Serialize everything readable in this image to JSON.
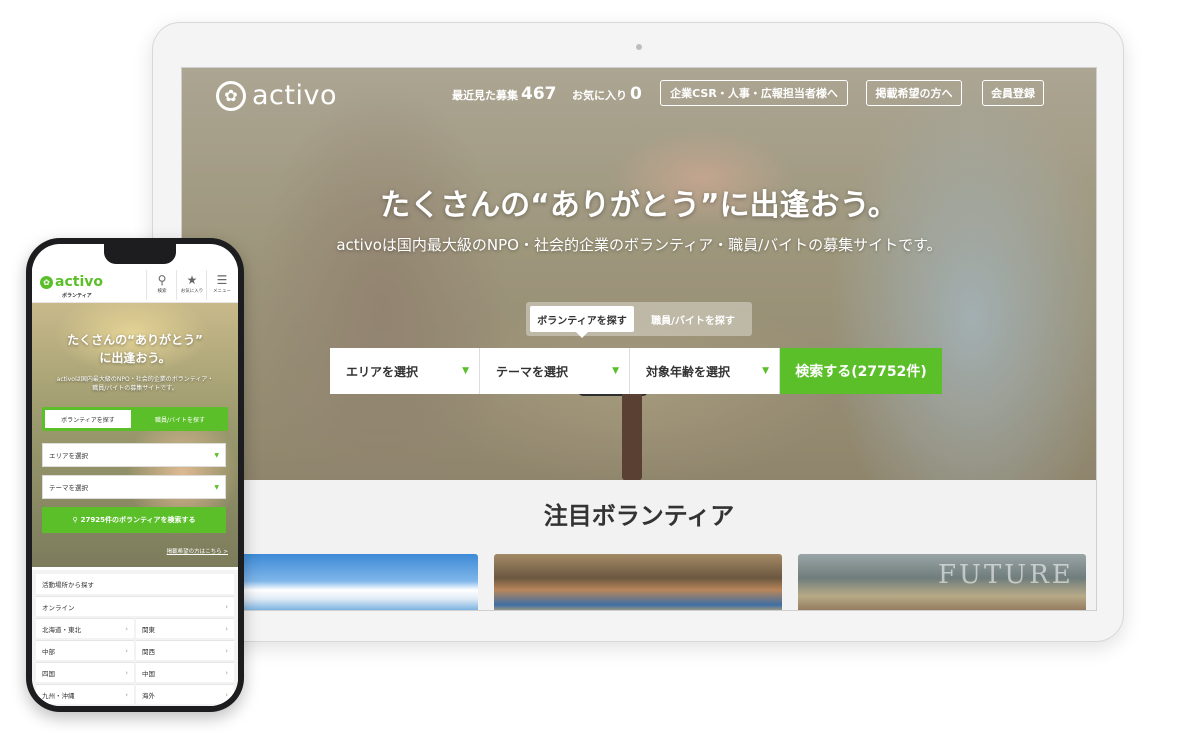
{
  "desktop": {
    "logo_text": "activo",
    "nav": {
      "recent_label": "最近見た募集",
      "recent_count": "467",
      "favorites_label": "お気に入り",
      "favorites_count": "0",
      "corporate_button": "企業CSR・人事・広報担当者様へ",
      "listing_button": "掲載希望の方へ",
      "signup_button": "会員登録"
    },
    "hero": {
      "title": "たくさんの“ありがとう”に出逢おう。",
      "subtitle": "activoは国内最大級のNPO・社会的企業のボランティア・職員/バイトの募集サイトです。"
    },
    "tabs": {
      "active": "ボランティアを探す",
      "inactive": "職員/バイトを探す"
    },
    "search": {
      "area": "エリアを選択",
      "theme": "テーマを選択",
      "age": "対象年齢を選択",
      "button": "検索する(27752件)"
    },
    "featured_title": "注目ボランティア",
    "card3_text": "FUTURE"
  },
  "mobile": {
    "logo_text": "activo",
    "logo_sub": "ボランティア",
    "icons": [
      {
        "label": "検索",
        "icon": "search-icon"
      },
      {
        "label": "お気に入り",
        "icon": "star-icon"
      },
      {
        "label": "メニュー",
        "icon": "menu-icon"
      }
    ],
    "hero_title_line1": "たくさんの“ありがとう”",
    "hero_title_line2": "に出逢おう。",
    "hero_sub": "activoは国内最大級のNPO・社会的企業のボランティア・職員/バイトの募集サイトです。",
    "tab_active": "ボランティアを探す",
    "tab_inactive": "職員/バイトを探す",
    "area_select": "エリアを選択",
    "theme_select": "テーマを選択",
    "search_button": "27925件のボランティアを検索する",
    "listing_link": "掲載希望の方はこちら >",
    "list_header": "活動場所から探す",
    "online": "オンライン",
    "regions": [
      "北海道・東北",
      "関東",
      "中部",
      "関西",
      "四国",
      "中国",
      "九州・沖縄",
      "海外"
    ]
  },
  "colors": {
    "accent_green": "#5bbf2a"
  }
}
